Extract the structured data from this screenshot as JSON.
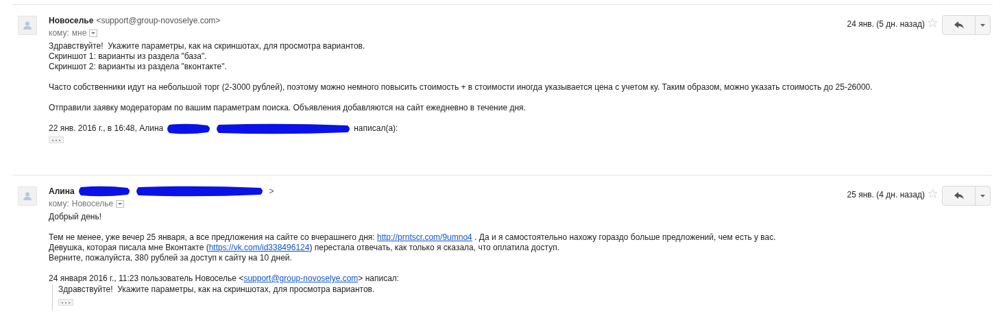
{
  "messages": [
    {
      "sender": "Новоселье",
      "email": "<support@group-novoselye.com>",
      "sender_redacted": false,
      "to_label": "кому:",
      "recipient": "мне",
      "date": "24 янв. (5 дн. назад)",
      "starred": false,
      "paragraphs": [
        [
          [
            {
              "text": "Здравствуйте!  Укажите параметры, как на скриншотах, для просмотра вариантов."
            }
          ],
          [
            {
              "text": "Скриншот 1: варианты из раздела \"база\"."
            }
          ],
          [
            {
              "text": "Скриншот 2: варианты из раздела \"вконтакте\"."
            }
          ]
        ],
        [
          [
            {
              "text": "Часто собственники идут на небольшой торг (2-3000 рублей), поэтому можно немного повысить стоимость + в стоимости иногда указывается цена с учетом ку. Таким образом, можно указать стоимость до 25-26000."
            }
          ]
        ],
        [
          [
            {
              "text": "Отправили заявку модераторам по вашим параметрам поиска. Объявления добавляются на сайт ежедневно в течение дня."
            }
          ]
        ]
      ],
      "attribution": {
        "before": "22 янв. 2016 г., в 16:48, Алина",
        "redacted": true,
        "after": "написал(а):"
      }
    },
    {
      "sender": "Алина",
      "email": ">",
      "sender_redacted": true,
      "to_label": "кому:",
      "recipient": "Новоселье",
      "date": "25 янв. (4 дн. назад)",
      "starred": false,
      "paragraphs": [
        [
          [
            {
              "text": "Добрый день!"
            }
          ]
        ],
        [
          [
            {
              "text": "Тем не менее, уже вечер 25 января, а все предложения на сайте со вчерашнего дня: ",
              "link": false
            },
            {
              "text": "http://prntscr.com/9umno4",
              "link": true
            },
            {
              "text": " . Да и я самостоятельно нахожу гораздо больше предложений, чем есть у вас.",
              "link": false
            }
          ],
          [
            {
              "text": "Девушка, которая писала мне Вконтакте (",
              "link": false
            },
            {
              "text": "https://vk.com/id338496124",
              "link": true
            },
            {
              "text": ") перестала отвечать, как только я сказала, что оплатила доступ.",
              "link": false
            }
          ],
          [
            {
              "text": "Верните, пожалуйста, 380 рублей за доступ к сайту на 10 дней."
            }
          ]
        ]
      ],
      "attribution": {
        "before": "24 января 2016 г., 11:23 пользователь Новоселье <",
        "redacted": false,
        "link": "support@group-novoselye.com",
        "after": "> написал:"
      },
      "quote": {
        "lines": [
          "Здравствуйте!  Укажите параметры, как на скриншотах, для просмотра вариантов."
        ]
      }
    }
  ]
}
